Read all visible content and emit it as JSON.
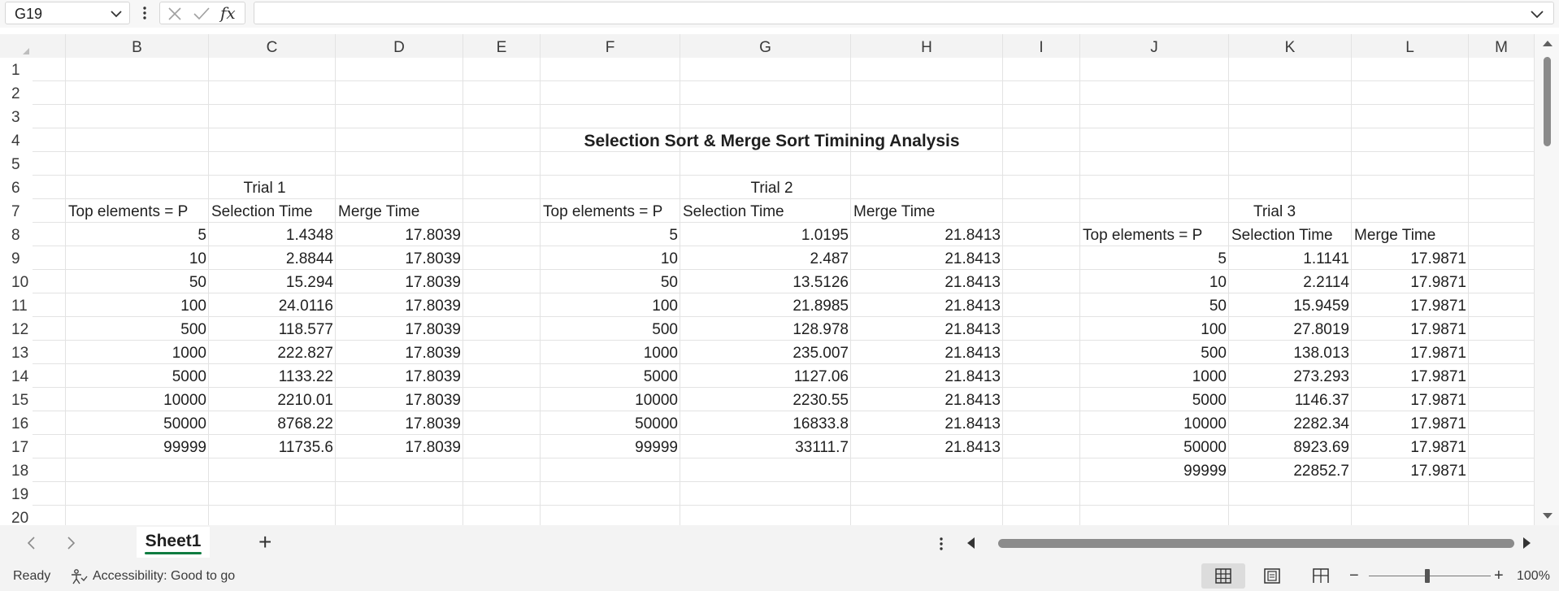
{
  "formula_bar": {
    "name_box": "G19",
    "fx_label": "fx",
    "formula_value": ""
  },
  "columns": [
    "B",
    "C",
    "D",
    "E",
    "F",
    "G",
    "H",
    "I",
    "J",
    "K",
    "L",
    "M"
  ],
  "rows": [
    "1",
    "2",
    "3",
    "4",
    "5",
    "6",
    "7",
    "8",
    "9",
    "10",
    "11",
    "12",
    "13",
    "14",
    "15",
    "16",
    "17",
    "18",
    "19",
    "20"
  ],
  "sheet": {
    "title": "Selection Sort & Merge Sort Timining Analysis",
    "trial1": {
      "label": "Trial 1",
      "headers": [
        "Top elements = P",
        "Selection Time",
        "Merge Time"
      ],
      "rows": [
        [
          "5",
          "1.4348",
          "17.8039"
        ],
        [
          "10",
          "2.8844",
          "17.8039"
        ],
        [
          "50",
          "15.294",
          "17.8039"
        ],
        [
          "100",
          "24.0116",
          "17.8039"
        ],
        [
          "500",
          "118.577",
          "17.8039"
        ],
        [
          "1000",
          "222.827",
          "17.8039"
        ],
        [
          "5000",
          "1133.22",
          "17.8039"
        ],
        [
          "10000",
          "2210.01",
          "17.8039"
        ],
        [
          "50000",
          "8768.22",
          "17.8039"
        ],
        [
          "99999",
          "11735.6",
          "17.8039"
        ]
      ]
    },
    "trial2": {
      "label": "Trial 2",
      "headers": [
        "Top elements = P",
        "Selection Time",
        "Merge Time"
      ],
      "rows": [
        [
          "5",
          "1.0195",
          "21.8413"
        ],
        [
          "10",
          "2.487",
          "21.8413"
        ],
        [
          "50",
          "13.5126",
          "21.8413"
        ],
        [
          "100",
          "21.8985",
          "21.8413"
        ],
        [
          "500",
          "128.978",
          "21.8413"
        ],
        [
          "1000",
          "235.007",
          "21.8413"
        ],
        [
          "5000",
          "1127.06",
          "21.8413"
        ],
        [
          "10000",
          "2230.55",
          "21.8413"
        ],
        [
          "50000",
          "16833.8",
          "21.8413"
        ],
        [
          "99999",
          "33111.7",
          "21.8413"
        ]
      ]
    },
    "trial3": {
      "label": "Trial 3",
      "headers": [
        "Top elements = P",
        "Selection Time",
        "Merge Time"
      ],
      "rows": [
        [
          "5",
          "1.1141",
          "17.9871"
        ],
        [
          "10",
          "2.2114",
          "17.9871"
        ],
        [
          "50",
          "15.9459",
          "17.9871"
        ],
        [
          "100",
          "27.8019",
          "17.9871"
        ],
        [
          "500",
          "138.013",
          "17.9871"
        ],
        [
          "1000",
          "273.293",
          "17.9871"
        ],
        [
          "5000",
          "1146.37",
          "17.9871"
        ],
        [
          "10000",
          "2282.34",
          "17.9871"
        ],
        [
          "50000",
          "8923.69",
          "17.9871"
        ],
        [
          "99999",
          "22852.7",
          "17.9871"
        ]
      ]
    }
  },
  "tabs": {
    "active_sheet": "Sheet1",
    "add_label": "+"
  },
  "status": {
    "ready": "Ready",
    "accessibility": "Accessibility: Good to go",
    "zoom": "100%"
  },
  "colors": {
    "accent_green": "#107c41",
    "grid_line": "#e3e3e3",
    "header_bg": "#f3f3f3"
  }
}
